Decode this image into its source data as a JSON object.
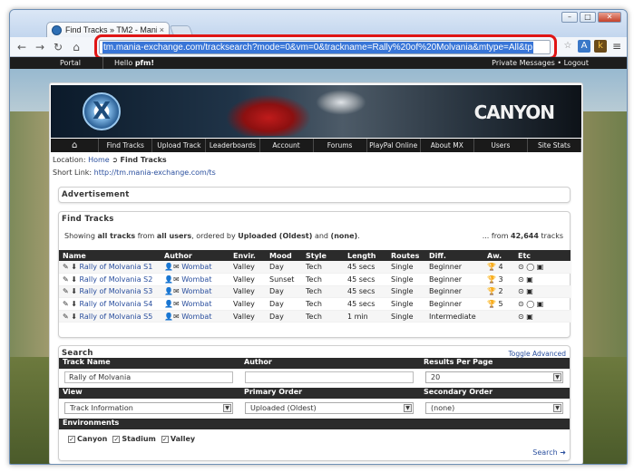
{
  "browser": {
    "tab_title": "Find Tracks » TM2 - Mani",
    "tab_close": "×",
    "window_controls": [
      "–",
      "□",
      "✕"
    ],
    "url": "tm.mania-exchange.com/tracksearch?mode=0&vm=0&trackname=Rally%20of%20Molvania&mtype=All&tp"
  },
  "topbar": {
    "portal": "Portal",
    "hello_prefix": "Hello ",
    "user": "pfm!",
    "right": "Private Messages • Logout"
  },
  "banner": {
    "logo": "X",
    "brand": "CANYON"
  },
  "nav": [
    "⌂",
    "Find Tracks",
    "Upload Track",
    "Leaderboards",
    "Account",
    "Forums",
    "PlayPal Online",
    "About MX",
    "Users",
    "Site Stats"
  ],
  "location": {
    "label": "Location: ",
    "home": "Home",
    "arrow": " ➲ ",
    "current": "Find Tracks"
  },
  "short_link": {
    "label": "Short Link: ",
    "url": "http://tm.mania-exchange.com/ts"
  },
  "advertisement": {
    "title": "Advertisement"
  },
  "find_tracks": {
    "title": "Find Tracks",
    "showing_1": "Showing ",
    "showing_b1": "all tracks",
    "showing_2": " from ",
    "showing_b2": "all users",
    "showing_3": ", ordered by ",
    "showing_b3": "Uploaded (Oldest)",
    "showing_4": " and ",
    "showing_b4": "(none)",
    "showing_5": ".",
    "count_prefix": "... from ",
    "count": "42,644",
    "count_suffix": " tracks",
    "columns": [
      "Name",
      "Author",
      "Envir.",
      "Mood",
      "Style",
      "Length",
      "Routes",
      "Diff.",
      "Aw.",
      "Etc"
    ],
    "rows": [
      {
        "name": "Rally of Molvania S1",
        "author": "Wombat",
        "env": "Valley",
        "mood": "Day",
        "style": "Tech",
        "length": "45 secs",
        "routes": "Single",
        "diff": "Beginner",
        "aw": "4",
        "etc": "⊙ ◯ ▣"
      },
      {
        "name": "Rally of Molvania S2",
        "author": "Wombat",
        "env": "Valley",
        "mood": "Sunset",
        "style": "Tech",
        "length": "45 secs",
        "routes": "Single",
        "diff": "Beginner",
        "aw": "3",
        "etc": "⊙ ▣"
      },
      {
        "name": "Rally of Molvania S3",
        "author": "Wombat",
        "env": "Valley",
        "mood": "Day",
        "style": "Tech",
        "length": "45 secs",
        "routes": "Single",
        "diff": "Beginner",
        "aw": "2",
        "etc": "⊙ ▣"
      },
      {
        "name": "Rally of Molvania S4",
        "author": "Wombat",
        "env": "Valley",
        "mood": "Day",
        "style": "Tech",
        "length": "45 secs",
        "routes": "Single",
        "diff": "Beginner",
        "aw": "5",
        "etc": "⊙ ◯ ▣"
      },
      {
        "name": "Rally of Molvania S5",
        "author": "Wombat",
        "env": "Valley",
        "mood": "Day",
        "style": "Tech",
        "length": "1 min",
        "routes": "Single",
        "diff": "Intermediate",
        "aw": "",
        "etc": "⊙ ▣"
      }
    ]
  },
  "search": {
    "title": "Search",
    "toggle": "Toggle Advanced",
    "h_track": "Track Name",
    "h_author": "Author",
    "h_results": "Results Per Page",
    "track_value": "Rally of Molvania",
    "author_value": "",
    "results_value": "20",
    "h_view": "View",
    "h_primary": "Primary Order",
    "h_secondary": "Secondary Order",
    "view_value": "Track Information",
    "primary_value": "Uploaded (Oldest)",
    "secondary_value": "(none)",
    "h_env": "Environments",
    "env1": "Canyon",
    "env2": "Stadium",
    "env3": "Valley",
    "check": "✓",
    "button": "Search ➜"
  }
}
